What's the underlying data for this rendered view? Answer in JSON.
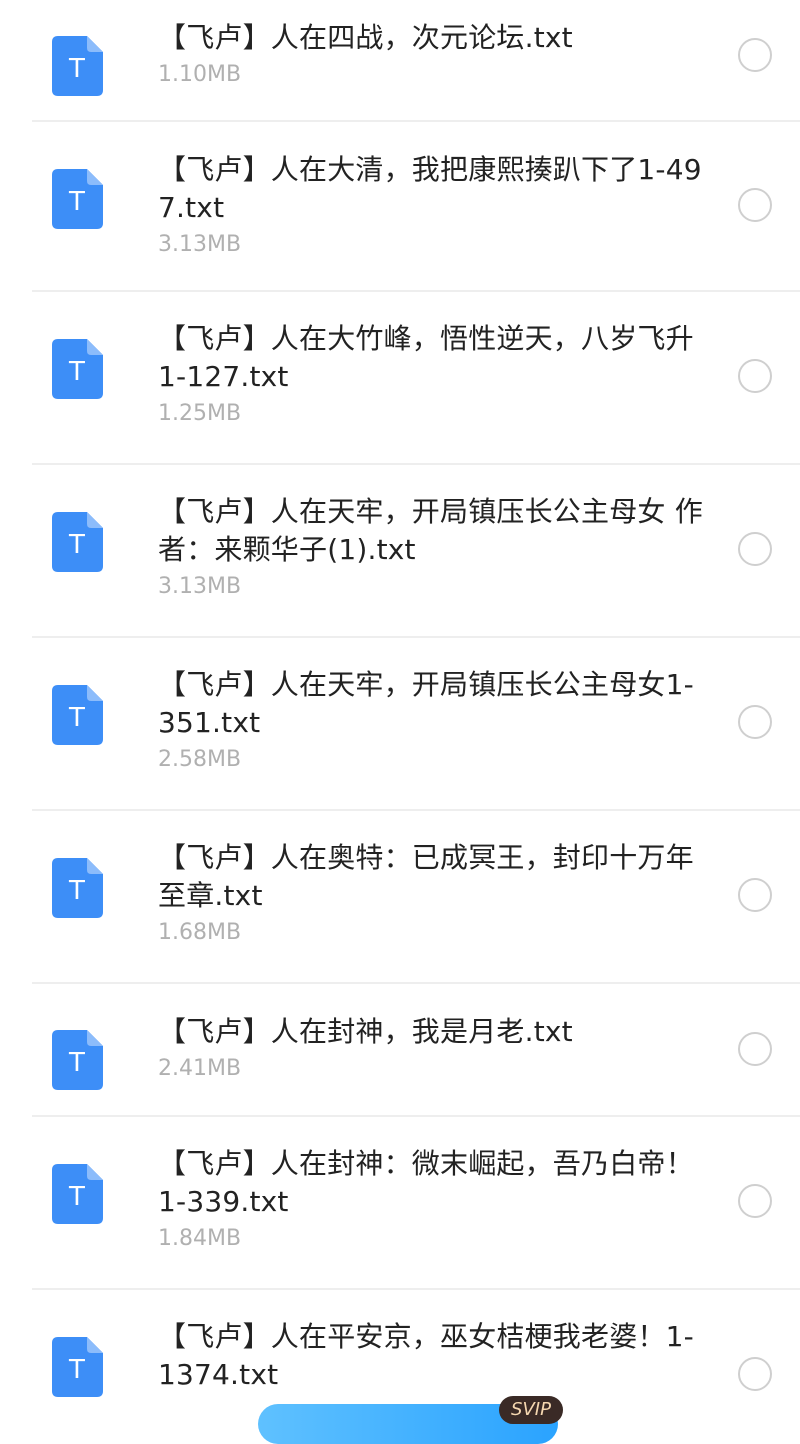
{
  "files": [
    {
      "name": "【飞卢】人在四战，次元论坛.txt",
      "size": "1.10MB"
    },
    {
      "name": "【飞卢】人在大清，我把康熙揍趴下了1-497.txt",
      "size": "3.13MB"
    },
    {
      "name": "【飞卢】人在大竹峰，悟性逆天，八岁飞升1-127.txt",
      "size": "1.25MB"
    },
    {
      "name": "【飞卢】人在天牢，开局镇压长公主母女 作者：来颗华子(1).txt",
      "size": "3.13MB"
    },
    {
      "name": "【飞卢】人在天牢，开局镇压长公主母女1-351.txt",
      "size": "2.58MB"
    },
    {
      "name": "【飞卢】人在奥特：已成冥王，封印十万年 至章.txt",
      "size": "1.68MB"
    },
    {
      "name": "【飞卢】人在封神，我是月老.txt",
      "size": "2.41MB"
    },
    {
      "name": "【飞卢】人在封神：微末崛起，吾乃白帝！1-339.txt",
      "size": "1.84MB"
    },
    {
      "name": "【飞卢】人在平安京，巫女桔梗我老婆！1-1374.txt",
      "size": ""
    }
  ],
  "icon": {
    "name": "txt-file-icon",
    "letter": "T",
    "color": "#3d8ef7"
  },
  "badge": {
    "label": "SVIP"
  }
}
